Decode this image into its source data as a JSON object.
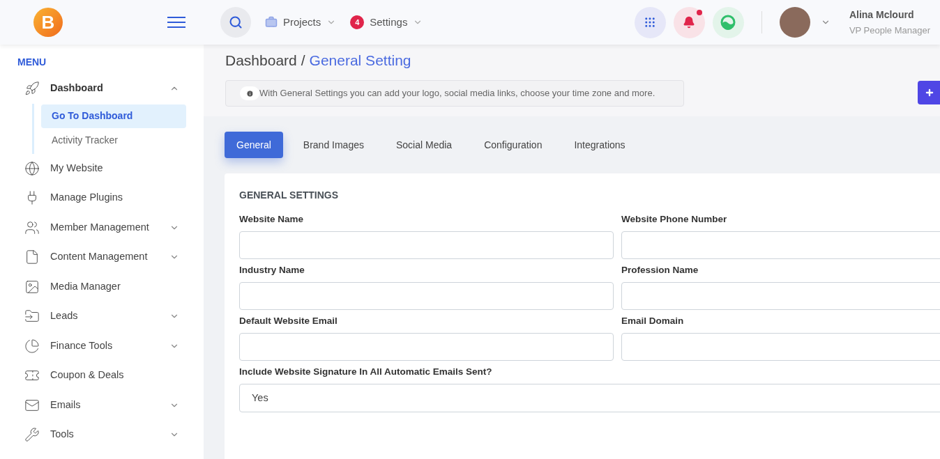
{
  "header": {
    "logo_letter": "B",
    "nav": [
      {
        "kind": "menu",
        "label": "Projects"
      },
      {
        "kind": "badge",
        "label": "Settings",
        "badge": "4"
      }
    ],
    "notification_dot": true,
    "user": {
      "name": "Alina Mclourd",
      "role": "VP People Manager"
    }
  },
  "sidebar": {
    "heading": "MENU",
    "items": [
      {
        "label": "Dashboard",
        "kind": "group",
        "expanded": true,
        "children": [
          {
            "label": "Go To Dashboard",
            "selected": true
          },
          {
            "label": "Activity Tracker",
            "selected": false
          }
        ]
      },
      {
        "label": "My Website",
        "kind": "link"
      },
      {
        "label": "Manage Plugins",
        "kind": "link"
      },
      {
        "label": "Member Management",
        "kind": "group",
        "expanded": false
      },
      {
        "label": "Content Management",
        "kind": "group",
        "expanded": false
      },
      {
        "label": "Media Manager",
        "kind": "link"
      },
      {
        "label": "Leads",
        "kind": "group",
        "expanded": false
      },
      {
        "label": "Finance Tools",
        "kind": "group",
        "expanded": false
      },
      {
        "label": "Coupon & Deals",
        "kind": "link"
      },
      {
        "label": "Emails",
        "kind": "group",
        "expanded": false
      },
      {
        "label": "Tools",
        "kind": "group",
        "expanded": false
      }
    ]
  },
  "breadcrumb_separator": "/",
  "breadcrumb": [
    {
      "label": "Dashboard",
      "current": false
    },
    {
      "label": "General Setting",
      "current": true
    }
  ],
  "info": "With General Settings you can add your logo, social media links, choose your time zone and more.",
  "tabs": [
    {
      "label": "General",
      "selected": true
    },
    {
      "label": "Brand Images",
      "selected": false
    },
    {
      "label": "Social Media",
      "selected": false
    },
    {
      "label": "Configuration",
      "selected": false
    },
    {
      "label": "Integrations",
      "selected": false
    }
  ],
  "form": {
    "title": "GENERAL SETTINGS",
    "fields": [
      {
        "label": "Website Name",
        "kind": "text"
      },
      {
        "label": "Website Phone Number",
        "kind": "text"
      },
      {
        "label": "Industry Name",
        "kind": "text"
      },
      {
        "label": "Profession Name",
        "kind": "text"
      },
      {
        "label": "Default Website Email",
        "kind": "text"
      },
      {
        "label": "Email Domain",
        "kind": "text"
      },
      {
        "label": "Include Website Signature In All Automatic Emails Sent?",
        "kind": "select",
        "value": "Yes"
      }
    ]
  }
}
